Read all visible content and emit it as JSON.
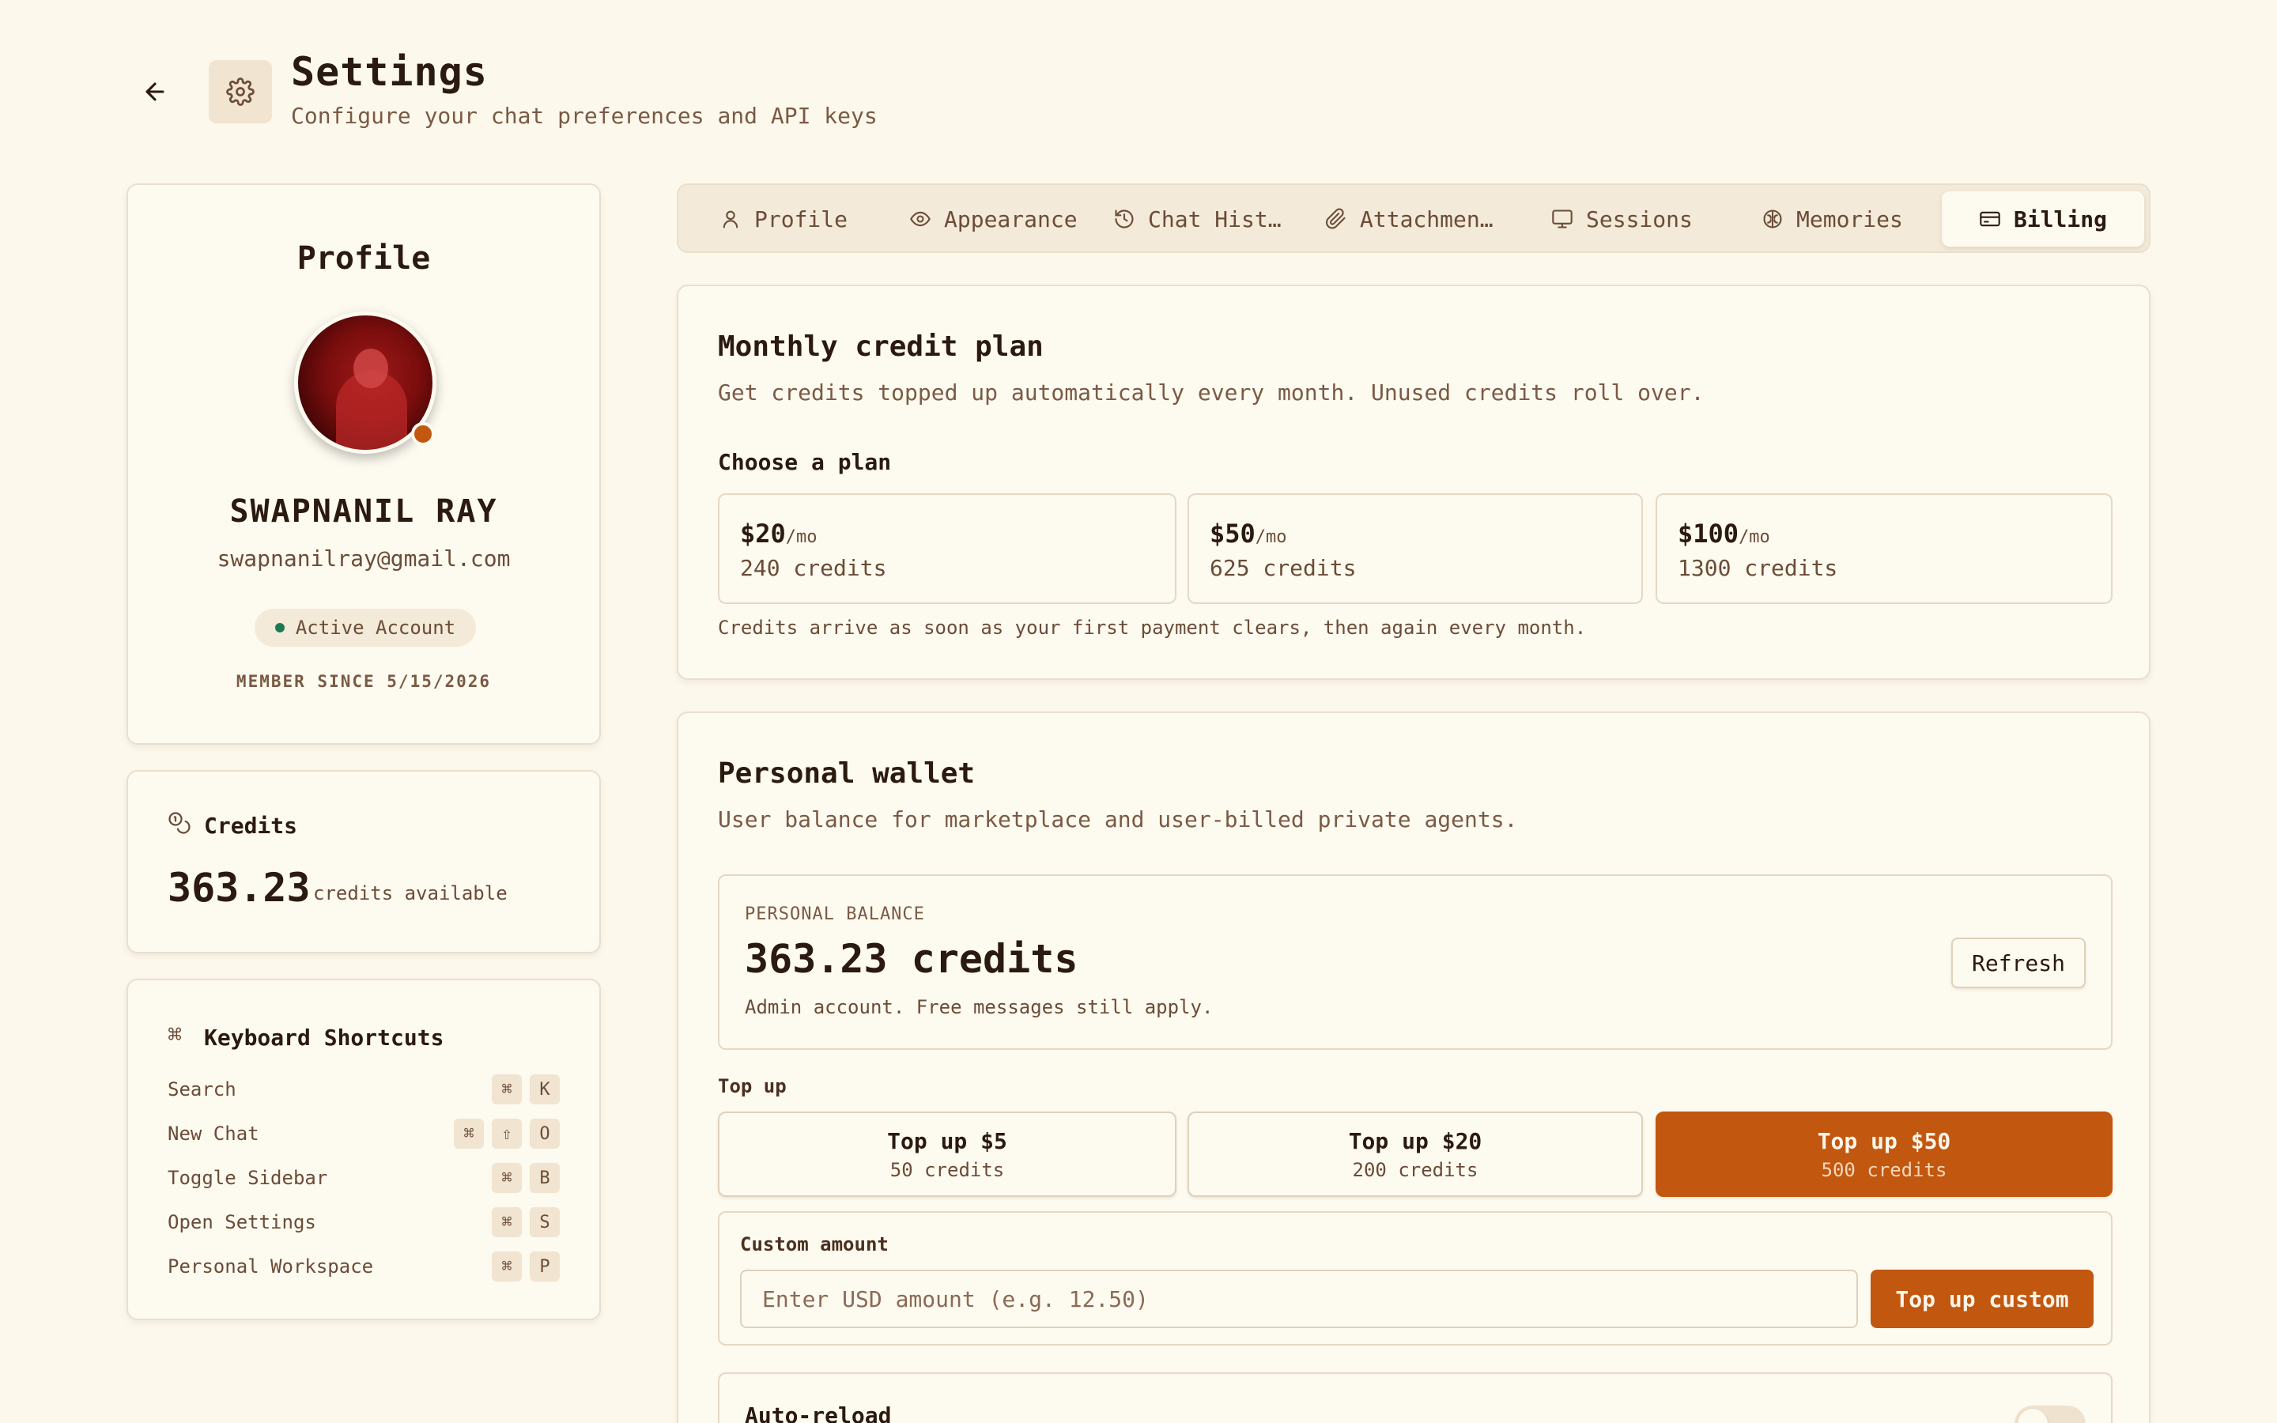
{
  "header": {
    "title": "Settings",
    "subtitle": "Configure your chat preferences and API keys",
    "back_icon": "arrow-left-icon",
    "settings_icon": "gear-icon"
  },
  "profile": {
    "title": "Profile",
    "name": "SWAPNANIL RAY",
    "email": "swapnanilray@gmail.com",
    "status": "Active Account",
    "member_since": "MEMBER SINCE 5/15/2026"
  },
  "credits": {
    "label": "Credits",
    "value": "363.23",
    "unit": "credits available"
  },
  "shortcuts": {
    "title": "Keyboard Shortcuts",
    "items": [
      {
        "label": "Search",
        "keys": [
          "⌘",
          "K"
        ]
      },
      {
        "label": "New Chat",
        "keys": [
          "⌘",
          "⇧",
          "O"
        ]
      },
      {
        "label": "Toggle Sidebar",
        "keys": [
          "⌘",
          "B"
        ]
      },
      {
        "label": "Open Settings",
        "keys": [
          "⌘",
          "S"
        ]
      },
      {
        "label": "Personal Workspace",
        "keys": [
          "⌘",
          "P"
        ]
      }
    ]
  },
  "tabs": [
    {
      "label": "Profile",
      "icon": "user-icon"
    },
    {
      "label": "Appearance",
      "icon": "eye-icon"
    },
    {
      "label": "Chat Hist…",
      "icon": "history-icon"
    },
    {
      "label": "Attachmen…",
      "icon": "paperclip-icon"
    },
    {
      "label": "Sessions",
      "icon": "monitor-icon"
    },
    {
      "label": "Memories",
      "icon": "brain-icon"
    },
    {
      "label": "Billing",
      "icon": "credit-card-icon",
      "active": true
    }
  ],
  "plan": {
    "title": "Monthly credit plan",
    "subtitle": "Get credits topped up automatically every month. Unused credits roll over.",
    "choose_label": "Choose a plan",
    "options": [
      {
        "price": "$20",
        "period": "/mo",
        "credits": "240 credits"
      },
      {
        "price": "$50",
        "period": "/mo",
        "credits": "625 credits"
      },
      {
        "price": "$100",
        "period": "/mo",
        "credits": "1300 credits"
      }
    ],
    "note": "Credits arrive as soon as your first payment clears, then again every month."
  },
  "wallet": {
    "title": "Personal wallet",
    "subtitle": "User balance for marketplace and user-billed private agents.",
    "balance_label": "PERSONAL BALANCE",
    "balance_value": "363.23 credits",
    "balance_note": "Admin account. Free messages still apply.",
    "refresh_label": "Refresh",
    "topup_label": "Top up",
    "topups": [
      {
        "label": "Top up $5",
        "credits": "50 credits"
      },
      {
        "label": "Top up $20",
        "credits": "200 credits"
      },
      {
        "label": "Top up $50",
        "credits": "500 credits",
        "active": true
      }
    ],
    "custom_label": "Custom amount",
    "custom_placeholder": "Enter USD amount (e.g. 12.50)",
    "custom_button": "Top up custom",
    "auto_reload_label": "Auto-reload"
  },
  "colors": {
    "accent": "#c2570f",
    "background": "#fcf8ec",
    "status_green": "#1c7a52"
  }
}
